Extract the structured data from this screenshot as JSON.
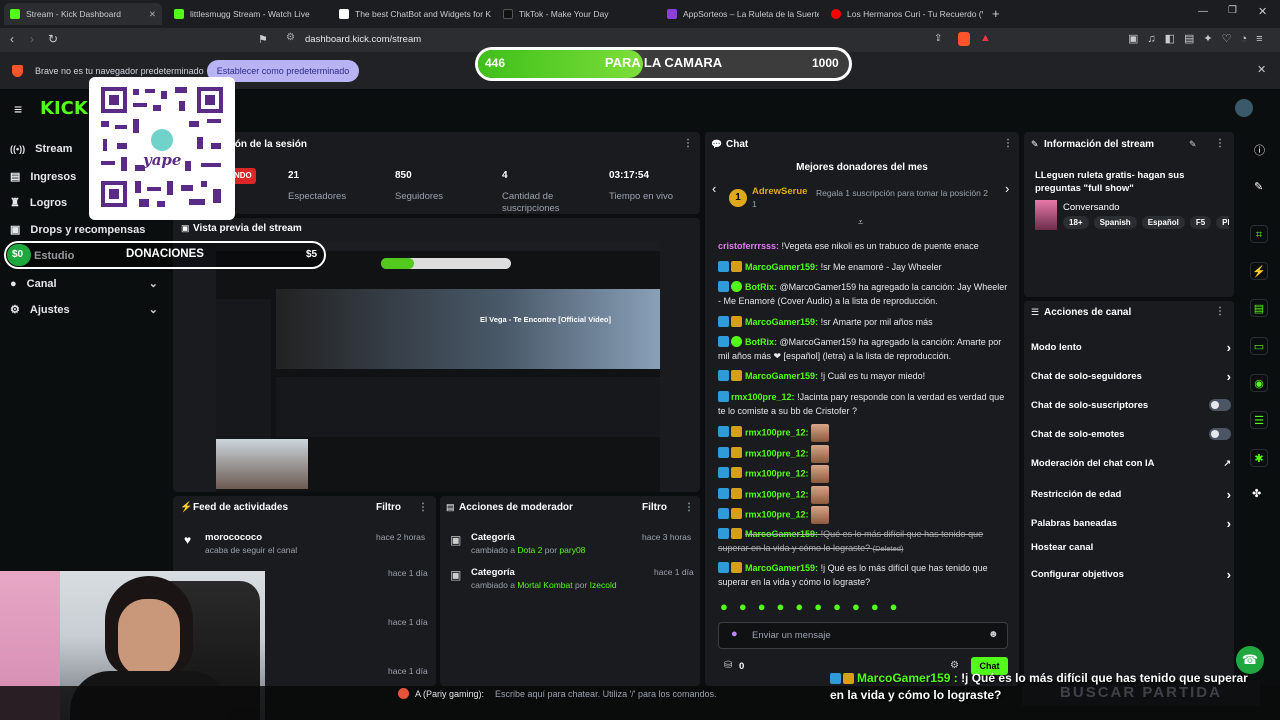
{
  "browser": {
    "tabs": [
      {
        "title": "Stream - Kick Dashboard",
        "color": "#53fc18"
      },
      {
        "title": "littlesmugg Stream - Watch Live",
        "color": "#53fc18"
      },
      {
        "title": "The best ChatBot and Widgets for Ki",
        "color": "#ffffff"
      },
      {
        "title": "TikTok - Make Your Day",
        "color": "#111111"
      },
      {
        "title": "AppSorteos – La Ruleta de la Suerte",
        "color": "#8b3fd8"
      },
      {
        "title": "Los Hermanos Curi - Tu Recuerdo (V",
        "color": "#ff0000"
      }
    ],
    "url": "dashboard.kick.com/stream",
    "infobar_text": "Brave no es tu navegador predeterminado",
    "infobar_button": "Establecer como predeterminado"
  },
  "overlay": {
    "goal_left": "446",
    "goal_label": "PARA LA CAMARA",
    "goal_right": "1000",
    "goal_progress": 0.446,
    "donation_amount": "$0",
    "donation_label": "DONACIONES",
    "donation_right": "$5",
    "qr_label": "yape",
    "bottom_chat_user": "MarcoGamer159 :",
    "bottom_chat_text": "!j Qué es lo más difícil que has tenido que superar en la vida y cómo lo lograste?",
    "buscar": "BUSCAR PARTIDA",
    "ffz_user": "A (Pariy gaming):",
    "ffz_placeholder": "Escribe aquí para chatear. Utiliza '/' para los comandos."
  },
  "sidebar": {
    "items": [
      {
        "label": "Stream",
        "icon": "broadcast-icon"
      },
      {
        "label": "Ingresos",
        "icon": "wallet-icon"
      },
      {
        "label": "Logros",
        "icon": "trophy-icon"
      },
      {
        "label": "Drops y recompensas",
        "icon": "gift-icon"
      },
      {
        "label": "Estudio",
        "icon": "studio-icon"
      },
      {
        "label": "Canal",
        "icon": "user-icon"
      },
      {
        "label": "Ajustes",
        "icon": "gear-icon"
      }
    ]
  },
  "session": {
    "title": "ión de la sesión",
    "status": "NDO",
    "stats": [
      {
        "value": "21",
        "label": "Espectadores"
      },
      {
        "value": "850",
        "label": "Seguidores"
      },
      {
        "value": "4",
        "label": "Cantidad de suscripciones"
      },
      {
        "value": "03:17:54",
        "label": "Tiempo en vivo"
      }
    ]
  },
  "preview": {
    "title": "Vista previa del stream",
    "video_title": "El Vega - Te Encontre [Official Video]"
  },
  "feed": {
    "title": "Feed de actividades",
    "filter": "Filtro",
    "rows": [
      {
        "user": "morocococo",
        "action": "acaba de seguir el canal",
        "time": "hace 2 horas"
      },
      {
        "user": "",
        "action": "",
        "time": "hace 1 día"
      },
      {
        "user": "",
        "action": "",
        "time": "hace 1 día"
      },
      {
        "user": "",
        "action": "",
        "time": "hace 1 día"
      }
    ]
  },
  "mod": {
    "title": "Acciones de moderador",
    "filter": "Filtro",
    "rows": [
      {
        "title": "Categoría",
        "pre": "cambiado a",
        "value": "Dota 2",
        "by": "por",
        "user": "pary08",
        "time": "hace 3 horas"
      },
      {
        "title": "Categoría",
        "pre": "cambiado a",
        "value": "Mortal Kombat",
        "by": "por",
        "user": "Izecold",
        "time": "hace 1 día"
      }
    ]
  },
  "chat": {
    "title": "Chat",
    "donors_title": "Mejores donadores del mes",
    "donor_name": "AdrewSerue",
    "donor_rank": "1",
    "donor_count": "1",
    "donor_cta": "Regala 1 suscripción para tomar la posición 2",
    "messages": [
      {
        "user": "cristoferrrsss:",
        "text": "!Vegeta ese nikoli es un trabuco de puente enace"
      },
      {
        "user": "MarcoGamer159:",
        "text": "!sr Me enamoré - Jay Wheeler"
      },
      {
        "user": "BotRix:",
        "text": "@MarcoGamer159 ha agregado la canción: Jay Wheeler - Me Enamoré (Cover Audio) a la lista de reproducción."
      },
      {
        "user": "MarcoGamer159:",
        "text": "!sr Amarte por mil años más"
      },
      {
        "user": "BotRix:",
        "text": "@MarcoGamer159 ha agregado la canción: Amarte por mil años más ❤ [español] (letra) a la lista de reproducción."
      },
      {
        "user": "MarcoGamer159:",
        "text": "!j Cuál es tu mayor miedo!"
      },
      {
        "user": "rmx100pre_12:",
        "text": "!Jacinta pary responde con la verdad es verdad que te lo comiste a su bb de Cristofer ?"
      },
      {
        "user": "rmx100pre_12:",
        "text": ""
      },
      {
        "user": "rmx100pre_12:",
        "text": ""
      },
      {
        "user": "rmx100pre_12:",
        "text": ""
      },
      {
        "user": "rmx100pre_12:",
        "text": ""
      },
      {
        "user": "rmx100pre_12:",
        "text": ""
      },
      {
        "user": "MarcoGamer159:",
        "text": "!Qué es lo más difícil que has tenido que superar en la vida y cómo lo lograste?",
        "deleted": "(Deleted)"
      },
      {
        "user": "MarcoGamer159:",
        "text": "!j Qué es lo más difícil que has tenido que superar en la vida y cómo lo lograste?"
      }
    ],
    "input_placeholder": "Enviar un mensaje",
    "points": "0",
    "send_label": "Chat"
  },
  "stream_info": {
    "title": "Información del stream",
    "stream_title": "LLeguen ruleta gratis- hagan sus preguntas \"full show\"",
    "category": "Conversando",
    "tags": [
      "18+",
      "Spanish",
      "Español",
      "F5",
      "Pl"
    ]
  },
  "channel_actions": {
    "title": "Acciones de canal",
    "items": [
      {
        "label": "Modo lento",
        "kind": "arrow"
      },
      {
        "label": "Chat de solo-seguidores",
        "kind": "arrow"
      },
      {
        "label": "Chat de solo-suscriptores",
        "kind": "toggle"
      },
      {
        "label": "Chat de solo-emotes",
        "kind": "toggle"
      },
      {
        "label": "Moderación del chat con IA",
        "kind": "link"
      },
      {
        "label": "Restricción de edad",
        "kind": "arrow"
      },
      {
        "label": "Palabras baneadas",
        "kind": "arrow"
      },
      {
        "label": "Hostear canal",
        "kind": "none"
      },
      {
        "label": "Configurar objetivos",
        "kind": "arrow"
      }
    ]
  }
}
